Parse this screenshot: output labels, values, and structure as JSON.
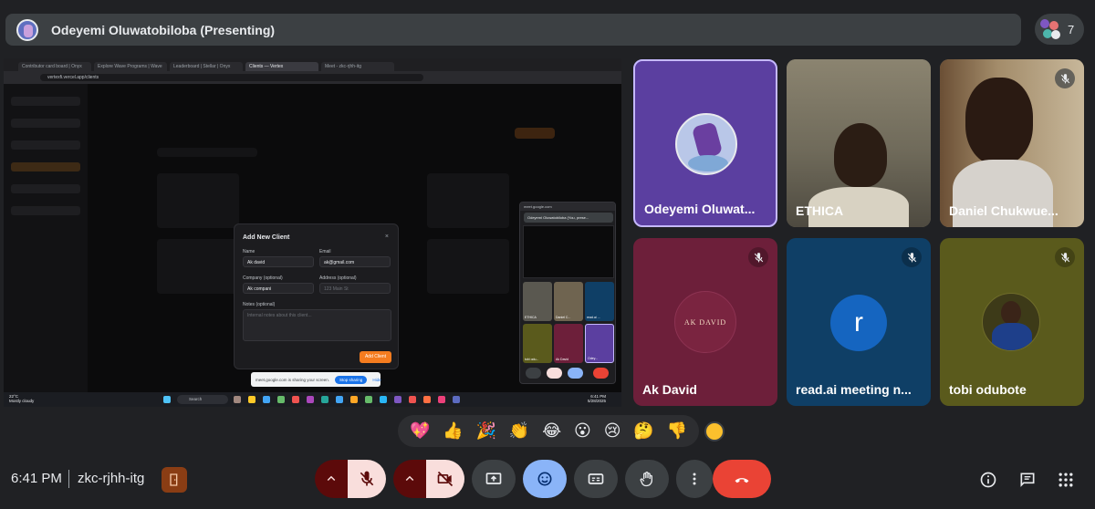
{
  "header": {
    "presenting_title": "Odeyemi Oluwatobiloba (Presenting)",
    "participant_count": "7"
  },
  "shared_screen": {
    "tabs": [
      "Contributor card board | Onyx",
      "Explore Wave Programs | Wave",
      "Leaderboard | Stellar | Onyx",
      "Clients — Vertex",
      "Meet - zkc-rjhh-itg"
    ],
    "url": "vertexfi.vercel.app/clients",
    "modal": {
      "title": "Add New Client",
      "close": "×",
      "name_label": "Name",
      "name_value": "Ak david",
      "email_label": "Email",
      "email_value": "ak@gmail.com",
      "company_label": "Company (optional)",
      "company_value": "Ak compani",
      "address_label": "Address (optional)",
      "address_placeholder": "123 Main St",
      "notes_label": "Notes (optional)",
      "notes_placeholder": "Internal notes about this client...",
      "submit": "Add Client"
    },
    "mini_meet": {
      "url": "meet.google.com",
      "presenting": "Odeyemi Oluwatobiloba (You, prese...",
      "tiles": [
        "ETHICA",
        "Daniel C...",
        "read.ai ...",
        "tobi odu...",
        "Ak David",
        "Odey..."
      ]
    },
    "share_toast": {
      "text": "meet.google.com is sharing your screen.",
      "stop": "Stop sharing",
      "hide": "Hide"
    },
    "taskbar": {
      "weather_temp": "22°C",
      "weather_desc": "Mostly cloudy",
      "search": "Search",
      "time": "6:41 PM",
      "date": "5/28/2025"
    }
  },
  "tiles": [
    {
      "name": "Odeyemi Oluwat...",
      "bg": "#5b3fa0",
      "muted": false
    },
    {
      "name": "ETHICA",
      "bg": "#6f6a5a",
      "muted": false
    },
    {
      "name": "Daniel Chukwue...",
      "bg": "#8a7a62",
      "muted": true
    },
    {
      "name": "Ak David",
      "bg": "#6d1f3a",
      "muted": true,
      "logo_text": "AK DAVID"
    },
    {
      "name": "read.ai meeting n...",
      "bg": "#0f3f66",
      "muted": true,
      "avatar_letter": "r"
    },
    {
      "name": "tobi odubote",
      "bg": "#5a5a1c",
      "muted": true
    }
  ],
  "reactions": [
    "💖",
    "👍",
    "🎉",
    "👏",
    "😂",
    "😮",
    "😢",
    "🤔",
    "👎"
  ],
  "footer": {
    "time": "6:41 PM",
    "meeting_code": "zkc-rjhh-itg"
  },
  "colors": {
    "background": "#202124",
    "control_bg": "#3c4043",
    "muted_red": "#f9dedc",
    "muted_dark": "#5c0a0a",
    "end_call": "#ea4335",
    "active_blue": "#8ab4f8"
  },
  "icons": {
    "mic": "mic-off-icon",
    "camera": "videocam-off-icon",
    "present": "present-screen-icon",
    "emoji": "emoji-icon",
    "captions": "captions-icon",
    "hand": "raise-hand-icon",
    "more": "more-vert-icon",
    "end": "call-end-icon",
    "info": "info-icon",
    "chat": "chat-icon",
    "activities": "apps-grid-icon"
  }
}
